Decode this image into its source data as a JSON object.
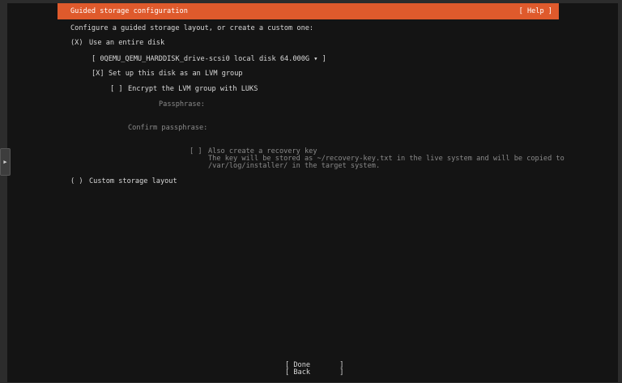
{
  "header": {
    "title": "Guided storage configuration",
    "help": "[ Help ]"
  },
  "intro": "Configure a guided storage layout, or create a custom one:",
  "entire_disk": {
    "radio": "(X)",
    "label": "Use an entire disk"
  },
  "disk_select": {
    "text": "[ 0QEMU_QEMU_HARDDISK_drive-scsi0 local disk 64.000G ▾ ]"
  },
  "lvm": {
    "checkbox": "[X]",
    "label": "Set up this disk as an LVM group"
  },
  "encrypt": {
    "checkbox": "[ ]",
    "label": "Encrypt the LVM group with LUKS"
  },
  "passphrase": {
    "label": "Passphrase:"
  },
  "confirm_passphrase": {
    "label": "Confirm passphrase:"
  },
  "recovery": {
    "checkbox": "[ ]",
    "label": "Also create a recovery key",
    "desc1": "The key will be stored as ~/recovery-key.txt in the live system and will be copied to",
    "desc2": "/var/log/installer/ in the target system."
  },
  "custom_layout": {
    "radio": "( )",
    "label": "Custom storage layout"
  },
  "buttons": {
    "done": "[ Done       ]",
    "back": "[ Back       ]"
  },
  "side_handle": {
    "icon": "play-arrow-icon"
  }
}
